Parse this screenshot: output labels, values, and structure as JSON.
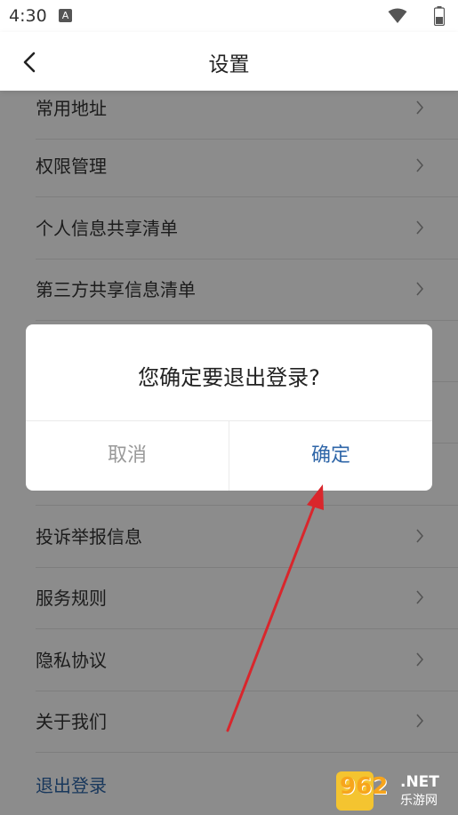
{
  "status_bar": {
    "time": "4:30",
    "badge": "A"
  },
  "app_bar": {
    "title": "设置"
  },
  "settings_items": [
    {
      "label": "常用地址"
    },
    {
      "label": "权限管理"
    },
    {
      "label": "个人信息共享清单"
    },
    {
      "label": "第三方共享信息清单"
    },
    {
      "label": ""
    },
    {
      "label": ""
    },
    {
      "label": ""
    },
    {
      "label": "投诉举报信息"
    },
    {
      "label": "服务规则"
    },
    {
      "label": "隐私协议"
    },
    {
      "label": "关于我们"
    }
  ],
  "logout": {
    "label": "退出登录"
  },
  "dialog": {
    "message": "您确定要退出登录?",
    "cancel_label": "取消",
    "confirm_label": "确定"
  },
  "watermark": {
    "number": "962",
    "suffix": ".NET",
    "caption": "乐游网"
  },
  "colors": {
    "accent": "#2f66a8",
    "scrim": "rgba(0,0,0,0.45)",
    "arrow": "#d9262c"
  },
  "icons": {
    "back": "chevron-left-icon",
    "row_arrow": "chevron-right-icon",
    "wifi": "wifi-icon",
    "battery": "battery-icon"
  }
}
